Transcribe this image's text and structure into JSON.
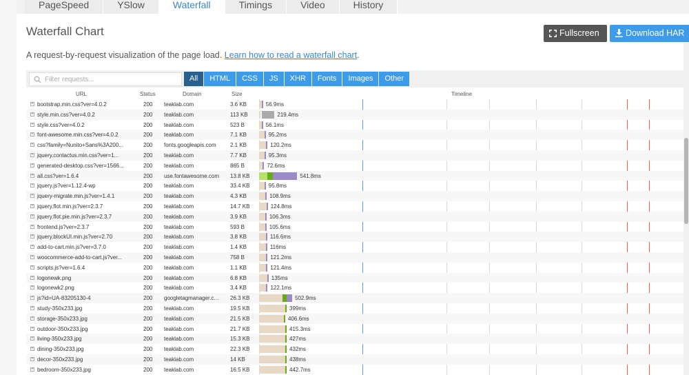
{
  "tabs": [
    {
      "label": "PageSpeed"
    },
    {
      "label": "YSlow"
    },
    {
      "label": "Waterfall",
      "active": true
    },
    {
      "label": "Timings"
    },
    {
      "label": "Video"
    },
    {
      "label": "History"
    }
  ],
  "title": "Waterfall Chart",
  "buttons": {
    "fullscreen": "Fullscreen",
    "download": "Download HAR"
  },
  "description": {
    "text": "A request-by-request visualization of the page load. ",
    "link": "Learn how to read a waterfall chart"
  },
  "description_suffix": ".",
  "filter": {
    "placeholder": "Filter requests..."
  },
  "chips": [
    {
      "label": "All",
      "active": true
    },
    {
      "label": "HTML"
    },
    {
      "label": "CSS"
    },
    {
      "label": "JS"
    },
    {
      "label": "XHR"
    },
    {
      "label": "Fonts"
    },
    {
      "label": "Images"
    },
    {
      "label": "Other"
    }
  ],
  "columns": {
    "url": "URL",
    "status": "Status",
    "domain": "Domain",
    "size": "Size",
    "timeline": "Timeline"
  },
  "colors": {
    "accent": "#3d9be9",
    "chip_active": "#286090",
    "bar_blocking": "#e8d8c6",
    "bar_wait": "#9a8ac8",
    "bar_dns": "#6aaa1a",
    "bar_connect": "#b7e06b",
    "bar_receive": "#aaaaaa"
  },
  "rows": [
    {
      "url": "bootstrap.min.css?ver=4.0.2",
      "status": "200",
      "domain": "teaklab.com",
      "size": "3.6 KB",
      "time": "56.9ms",
      "start": 0,
      "ms": 56.9,
      "type": "css"
    },
    {
      "url": "style.min.css?ver=4.0.2",
      "status": "200",
      "domain": "teaklab.com",
      "size": "113 KB",
      "time": "219.4ms",
      "start": 0,
      "ms": 219.4,
      "type": "big"
    },
    {
      "url": "style.css?ver=4.0.2",
      "status": "200",
      "domain": "teaklab.com",
      "size": "523 B",
      "time": "56.1ms",
      "start": 0,
      "ms": 56.1,
      "type": "css"
    },
    {
      "url": "font-awesome.min.css?ver=4.0.2",
      "status": "200",
      "domain": "teaklab.com",
      "size": "7.1 KB",
      "time": "95.2ms",
      "start": 0,
      "ms": 95.2,
      "type": "css"
    },
    {
      "url": "css?family=Nunito+Sans%3A200...",
      "status": "200",
      "domain": "fonts.googleapis.com",
      "size": "2.1 KB",
      "time": "120.2ms",
      "start": 0,
      "ms": 120.2,
      "type": "css"
    },
    {
      "url": "jquery.contactus.min.css?ver=1...",
      "status": "200",
      "domain": "teaklab.com",
      "size": "7.7 KB",
      "time": "95.3ms",
      "start": 0,
      "ms": 95.3,
      "type": "css"
    },
    {
      "url": "generated-desktop.css?ver=1566...",
      "status": "200",
      "domain": "teaklab.com",
      "size": "865 B",
      "time": "72.6ms",
      "start": 0,
      "ms": 72.6,
      "type": "css"
    },
    {
      "url": "all.css?ver=1.6.4",
      "status": "200",
      "domain": "use.fontawesome.com",
      "size": "13.8 KB",
      "time": "541.8ms",
      "start": 0,
      "ms": 541.8,
      "type": "ext"
    },
    {
      "url": "jquery.js?ver=1.12.4-wp",
      "status": "200",
      "domain": "teaklab.com",
      "size": "33.4 KB",
      "time": "95.8ms",
      "start": 0,
      "ms": 95.8,
      "type": "js"
    },
    {
      "url": "jquery-migrate.min.js?ver=1.4.1",
      "status": "200",
      "domain": "teaklab.com",
      "size": "4.3 KB",
      "time": "108.9ms",
      "start": 0,
      "ms": 108.9,
      "type": "js"
    },
    {
      "url": "jquery.flot.min.js?ver=2.3.7",
      "status": "200",
      "domain": "teaklab.com",
      "size": "14.7 KB",
      "time": "124.8ms",
      "start": 0,
      "ms": 124.8,
      "type": "js"
    },
    {
      "url": "jquery.flot.pie.min.js?ver=2.3.7",
      "status": "200",
      "domain": "teaklab.com",
      "size": "3.9 KB",
      "time": "106.3ms",
      "start": 0,
      "ms": 106.3,
      "type": "js"
    },
    {
      "url": "frontend.js?ver=2.3.7",
      "status": "200",
      "domain": "teaklab.com",
      "size": "593 B",
      "time": "105.6ms",
      "start": 0,
      "ms": 105.6,
      "type": "js"
    },
    {
      "url": "jquery.blockUI.min.js?ver=2.70",
      "status": "200",
      "domain": "teaklab.com",
      "size": "3.8 KB",
      "time": "116.6ms",
      "start": 0,
      "ms": 116.6,
      "type": "js"
    },
    {
      "url": "add-to-cart.min.js?ver=3.7.0",
      "status": "200",
      "domain": "teaklab.com",
      "size": "1.4 KB",
      "time": "116ms",
      "start": 0,
      "ms": 116,
      "type": "js"
    },
    {
      "url": "woocommerce-add-to-cart.js?ver...",
      "status": "200",
      "domain": "teaklab.com",
      "size": "758 B",
      "time": "121.2ms",
      "start": 0,
      "ms": 121.2,
      "type": "js"
    },
    {
      "url": "scripts.js?ver=1.6.4",
      "status": "200",
      "domain": "teaklab.com",
      "size": "1.1 KB",
      "time": "121.4ms",
      "start": 0,
      "ms": 121.4,
      "type": "js"
    },
    {
      "url": "logonewk.png",
      "status": "200",
      "domain": "teaklab.com",
      "size": "6.8 KB",
      "time": "135ms",
      "start": 0,
      "ms": 135,
      "type": "img"
    },
    {
      "url": "logonewk2.png",
      "status": "200",
      "domain": "teaklab.com",
      "size": "3.4 KB",
      "time": "122.1ms",
      "start": 0,
      "ms": 122.1,
      "type": "img"
    },
    {
      "url": "js?id=UA-83205130-4",
      "status": "200",
      "domain": "googletagmanager.c...",
      "size": "26.3 KB",
      "time": "502.9ms",
      "start": 0,
      "ms": 502.9,
      "type": "gtm"
    },
    {
      "url": "study-350x233.jpg",
      "status": "200",
      "domain": "teaklab.com",
      "size": "19.5 KB",
      "time": "399ms",
      "start": 0,
      "ms": 399,
      "type": "late"
    },
    {
      "url": "storage-350x233.jpg",
      "status": "200",
      "domain": "teaklab.com",
      "size": "21.5 KB",
      "time": "406.6ms",
      "start": 0,
      "ms": 406.6,
      "type": "late"
    },
    {
      "url": "outdoor-350x233.jpg",
      "status": "200",
      "domain": "teaklab.com",
      "size": "21.7 KB",
      "time": "415.3ms",
      "start": 0,
      "ms": 415.3,
      "type": "late"
    },
    {
      "url": "living-350x233.jpg",
      "status": "200",
      "domain": "teaklab.com",
      "size": "15.3 KB",
      "time": "427ms",
      "start": 0,
      "ms": 427,
      "type": "late"
    },
    {
      "url": "dining-350x233.jpg",
      "status": "200",
      "domain": "teaklab.com",
      "size": "22.3 KB",
      "time": "432ms",
      "start": 0,
      "ms": 432,
      "type": "late"
    },
    {
      "url": "decor-350x233.jpg",
      "status": "200",
      "domain": "teaklab.com",
      "size": "14 KB",
      "time": "438ms",
      "start": 0,
      "ms": 438,
      "type": "late"
    },
    {
      "url": "bedroom-350x233.jpg",
      "status": "200",
      "domain": "teaklab.com",
      "size": "16.5 KB",
      "time": "442.7ms",
      "start": 0,
      "ms": 442.7,
      "type": "late"
    }
  ]
}
